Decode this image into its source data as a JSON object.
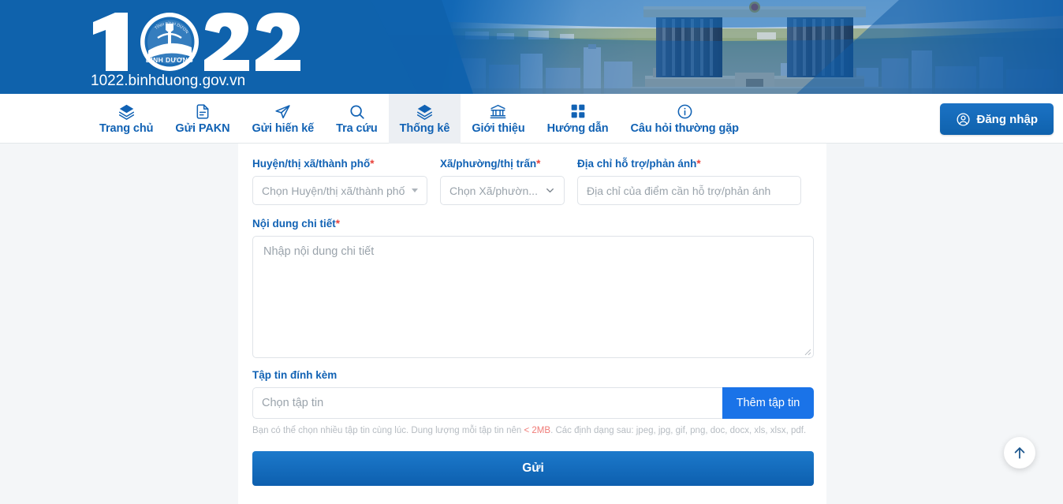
{
  "site": {
    "logo_number": "1022",
    "logo_badge": "BÌNH DƯƠNG",
    "domain": "1022.binhduong.gov.vn",
    "banner_alt": "binh-duong-administrative-center-photo"
  },
  "nav": {
    "items": [
      {
        "label": "Trang chủ",
        "icon": "layers-icon",
        "active": false
      },
      {
        "label": "Gửi PAKN",
        "icon": "document-icon",
        "active": false
      },
      {
        "label": "Gửi hiến kế",
        "icon": "send-icon",
        "active": false
      },
      {
        "label": "Tra cứu",
        "icon": "search-icon",
        "active": false
      },
      {
        "label": "Thống kê",
        "icon": "layers-icon",
        "active": true
      },
      {
        "label": "Giới thiệu",
        "icon": "building-icon",
        "active": false
      },
      {
        "label": "Hướng dẫn",
        "icon": "grid-icon",
        "active": false
      },
      {
        "label": "Câu hỏi thường gặp",
        "icon": "info-icon",
        "active": false
      }
    ],
    "login_label": "Đăng nhập",
    "login_icon": "user-circle-icon"
  },
  "form": {
    "district": {
      "label": "Huyện/thị xã/thành phố",
      "required_mark": "*",
      "placeholder": "Chọn Huyện/thị xã/thành phố",
      "value": ""
    },
    "ward": {
      "label": "Xã/phường/thị trấn",
      "required_mark": "*",
      "placeholder": "Chọn Xã/phườn...",
      "value": ""
    },
    "address": {
      "label": "Địa chỉ hỗ trợ/phản ánh",
      "required_mark": "*",
      "placeholder": "Địa chỉ của điểm cần hỗ trợ/phản ánh",
      "value": ""
    },
    "content": {
      "label": "Nội dung chi tiết",
      "required_mark": "*",
      "placeholder": "Nhập nội dung chi tiết",
      "value": ""
    },
    "attachment": {
      "label": "Tập tin đính kèm",
      "placeholder": "Chọn tập tin",
      "value": "",
      "button_label": "Thêm tập tin",
      "helper_prefix": "Bạn có thể chọn nhiều tập tin cùng lúc. Dung lượng mỗi tập tin nên ",
      "helper_highlight": "< 2MB",
      "helper_suffix": ". Các định dạng sau: jpeg, jpg, gif, png, doc, docx, xls, xlsx, pdf."
    },
    "submit_label": "Gửi"
  },
  "widgets": {
    "scroll_top_icon": "arrow-up-icon"
  },
  "colors": {
    "brand_blue": "#1162b4",
    "banner_blue": "#0f62ac",
    "accent_button": "#1a73e8",
    "required_red": "#e8413a",
    "helper_gray": "#b6bcc2",
    "page_bg": "#f4f6f8"
  }
}
